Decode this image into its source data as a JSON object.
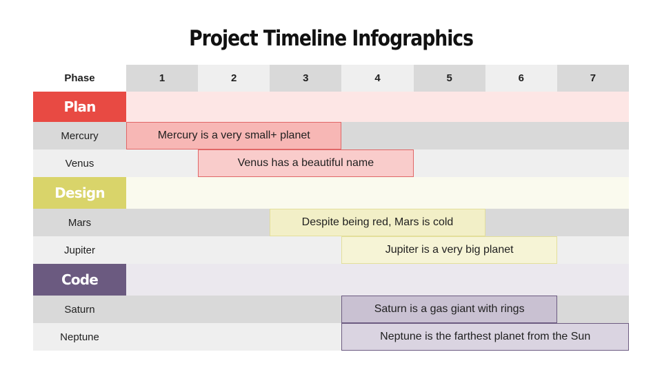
{
  "title": "Project Timeline Infographics",
  "header": {
    "phase_label": "Phase",
    "columns": [
      "1",
      "2",
      "3",
      "4",
      "5",
      "6",
      "7"
    ]
  },
  "sections": [
    {
      "name": "Plan",
      "color": "#e84a43",
      "tint": "#fde6e5",
      "bar_fill": [
        "#f7b7b5",
        "#f9cccb"
      ],
      "bar_border": "#e06666",
      "items": [
        {
          "label": "Mercury",
          "text": "Mercury is a very small+ planet",
          "start": 1,
          "end": 3
        },
        {
          "label": "Venus",
          "text": "Venus has a beautiful name",
          "start": 2,
          "end": 4
        }
      ]
    },
    {
      "name": "Design",
      "color": "#d9d46a",
      "tint": "#fafaee",
      "bar_fill": [
        "#f2efc7",
        "#f6f4d6"
      ],
      "bar_border": "#e3df9a",
      "items": [
        {
          "label": "Mars",
          "text": "Despite being red, Mars is cold",
          "start": 3,
          "end": 5
        },
        {
          "label": "Jupiter",
          "text": "Jupiter is a very big planet",
          "start": 4,
          "end": 6
        }
      ]
    },
    {
      "name": "Code",
      "color": "#6b5a80",
      "tint": "#ebe8ee",
      "bar_fill": [
        "#c9c1d2",
        "#dad4e1"
      ],
      "bar_border": "#6b5a80",
      "items": [
        {
          "label": "Saturn",
          "text": "Saturn is a gas giant with rings",
          "start": 4,
          "end": 6
        },
        {
          "label": "Neptune",
          "text": "Neptune is the farthest planet from the Sun",
          "start": 4,
          "end": 7
        }
      ]
    }
  ]
}
